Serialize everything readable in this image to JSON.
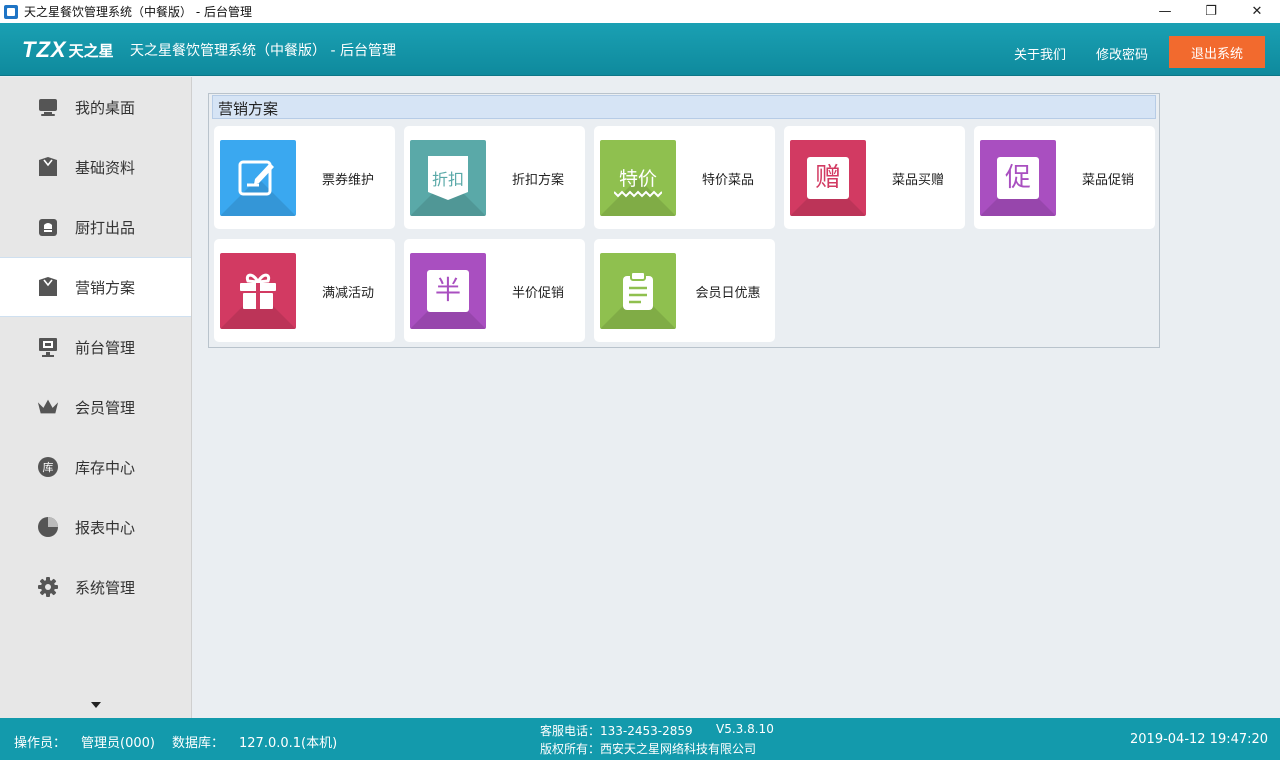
{
  "window": {
    "title": "天之星餐饮管理系统（中餐版） - 后台管理",
    "controls": {
      "minimize": "—",
      "restore": "❐",
      "close": "✕"
    }
  },
  "header": {
    "logo_mark": "TZX",
    "logo_brand": "天之星",
    "title": "天之星餐饮管理系统（中餐版） - 后台管理",
    "about": "关于我们",
    "change_password": "修改密码",
    "logout": "退出系统"
  },
  "sidebar": {
    "items": [
      {
        "label": "我的桌面",
        "icon": "monitor-icon"
      },
      {
        "label": "基础资料",
        "icon": "package-icon"
      },
      {
        "label": "厨打出品",
        "icon": "chef-hat-icon"
      },
      {
        "label": "营销方案",
        "icon": "package-icon",
        "active": true
      },
      {
        "label": "前台管理",
        "icon": "screen-icon"
      },
      {
        "label": "会员管理",
        "icon": "crown-icon"
      },
      {
        "label": "库存中心",
        "icon": "warehouse-icon",
        "badge": "库"
      },
      {
        "label": "报表中心",
        "icon": "pie-chart-icon"
      },
      {
        "label": "系统管理",
        "icon": "gear-icon"
      }
    ]
  },
  "panel": {
    "title": "营销方案",
    "cards": [
      {
        "label": "票券维护",
        "color": "#3aa8f0",
        "glyph": ""
      },
      {
        "label": "折扣方案",
        "color": "#5aa9a8",
        "glyph": "折扣"
      },
      {
        "label": "特价菜品",
        "color": "#8fc04f",
        "glyph": "特价"
      },
      {
        "label": "菜品买赠",
        "color": "#d23a62",
        "glyph": "赠"
      },
      {
        "label": "菜品促销",
        "color": "#a94fc0",
        "glyph": "促"
      },
      {
        "label": "满减活动",
        "color": "#d23a62",
        "glyph": ""
      },
      {
        "label": "半价促销",
        "color": "#a94fc0",
        "glyph": "半"
      },
      {
        "label": "会员日优惠",
        "color": "#8fc04f",
        "glyph": ""
      }
    ]
  },
  "footer": {
    "operator_label": "操作员：",
    "operator_value": "管理员(000)",
    "db_label": "数据库：",
    "db_value": "127.0.0.1(本机)",
    "hotline": "客服电话：133-2453-2859",
    "version": "V5.3.8.10",
    "copyright": "版权所有：西安天之星网络科技有限公司",
    "datetime": "2019-04-12 19:47:20"
  }
}
